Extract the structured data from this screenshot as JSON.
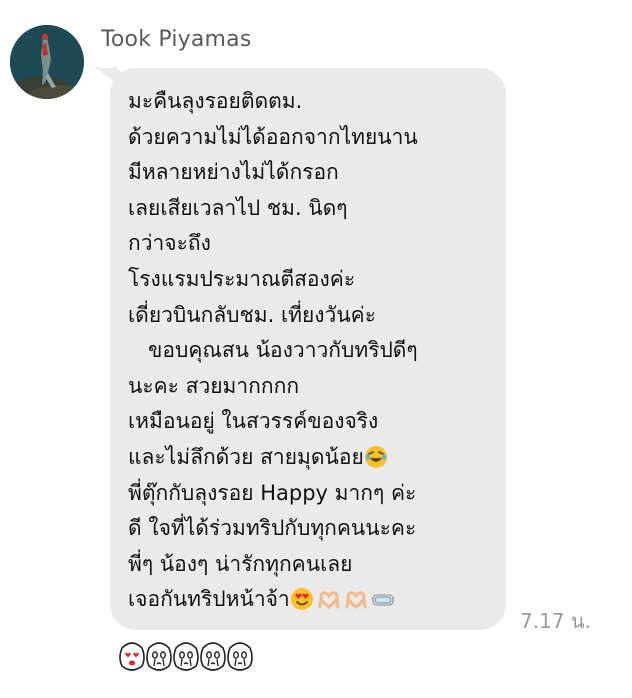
{
  "sender": {
    "name": "Took Piyamas"
  },
  "message": {
    "lines": [
      "มะคืนลุงรอยติดตม.",
      "ด้วยความไม่ได้ออกจากไทยนาน",
      "มีหลายหย่างไม่ได้กรอก",
      "เลยเสียเวลาไป ชม. นิดๆ",
      "กว่าจะถึง",
      "โรงแรมประมาณตีสองค่ะ",
      "เดี่ยวบินกลับชม. เที่ยงวันค่ะ",
      "   ขอบคุณสน น้องวาวกับทริปดีๆ",
      "นะคะ สวยมากกกก",
      "เหมือนอยู่ ในสวรรค์ของจริง",
      "และไม่ลึกด้วย สายมุดน้อย",
      "พี่ตุ๊กกับลุงรอย Happy มากๆ ค่ะ",
      "ดี ใจที่ได้ร่วมทริปกับทุกคนนะคะ",
      "พี่ๆ น้องๆ น่ารักทุกคนเลย",
      "เจอกันทริปหน้าจ้า"
    ],
    "timestamp": "7.17 น."
  },
  "emojis": {
    "line11": "rolling-on-floor-laughing-emoji",
    "line15": [
      "heart-eyes-emoji",
      "heart-hands-emoji",
      "heart-hands-emoji",
      "diving-mask-emoji"
    ]
  },
  "reactions": [
    "heart-eyes-sticker-icon",
    "teary-sticker-icon",
    "teary-sticker-icon",
    "teary-sticker-icon",
    "teary-sticker-icon"
  ],
  "colors": {
    "bubble": "#eaeaea",
    "sender_text": "#5a5a5a",
    "timestamp_text": "#9a9a9a",
    "message_text": "#111111"
  }
}
